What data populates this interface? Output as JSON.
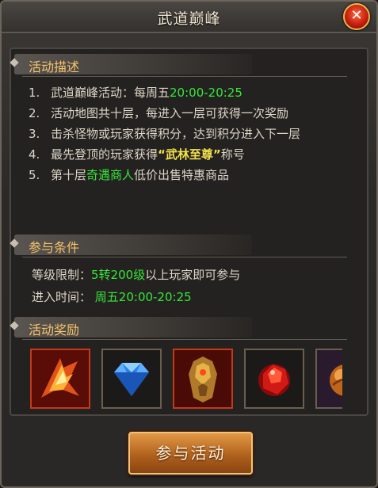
{
  "window": {
    "title": "武道巅峰",
    "close_label": "✕"
  },
  "description": {
    "heading": "活动描述",
    "items": [
      {
        "num": "1.",
        "text": "武道巅峰活动：每周五",
        "highlight": "20:00-20:25",
        "after": ""
      },
      {
        "num": "2.",
        "text": "活动地图共十层，每进入一层可获得一次奖励",
        "highlight": "",
        "after": ""
      },
      {
        "num": "3.",
        "text": "击杀怪物或玩家获得积分，达到积分进入下一层",
        "highlight": "",
        "after": ""
      },
      {
        "num": "4.",
        "text": "最先登顶的玩家获得",
        "highlight": "“武林至尊”",
        "after": "称号"
      },
      {
        "num": "5.",
        "text": "第十层",
        "highlight": "奇遇商人",
        "after": "低价出售特惠商品"
      }
    ]
  },
  "conditions": {
    "heading": "参与条件",
    "level_label": "等级限制：",
    "level_value": "5转200级",
    "level_suffix": "以上玩家即可参与",
    "time_label": "进入时间：",
    "time_value": "周五20:00-20:25"
  },
  "rewards": {
    "heading": "活动奖励",
    "items": [
      {
        "icon": "flame-weapon-icon"
      },
      {
        "icon": "diamond-icon"
      },
      {
        "icon": "armor-icon"
      },
      {
        "icon": "red-gem-icon"
      },
      {
        "icon": "orb-icon"
      }
    ]
  },
  "join_button": "参与活动",
  "colors": {
    "highlight_green": "#35e63a",
    "highlight_yellow": "#f4e14b",
    "section_text": "#f5c36a"
  }
}
